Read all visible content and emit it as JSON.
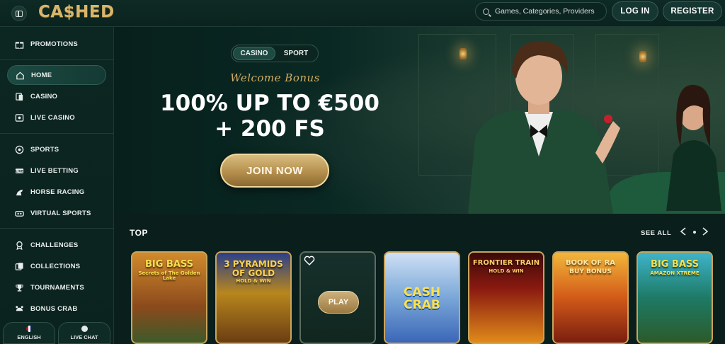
{
  "header": {
    "logo": "CA$HED",
    "search_placeholder": "Games, Categories, Providers",
    "login_label": "LOG IN",
    "register_label": "REGISTER"
  },
  "sidebar": {
    "items": [
      {
        "label": "PROMOTIONS",
        "icon": "gift-icon"
      },
      {
        "label": "HOME",
        "icon": "home-icon",
        "active": true
      },
      {
        "label": "CASINO",
        "icon": "cards-icon"
      },
      {
        "label": "LIVE CASINO",
        "icon": "live-cards-icon"
      },
      {
        "label": "SPORTS",
        "icon": "sports-icon"
      },
      {
        "label": "LIVE BETTING",
        "icon": "live-icon"
      },
      {
        "label": "HORSE RACING",
        "icon": "horse-icon"
      },
      {
        "label": "VIRTUAL SPORTS",
        "icon": "vr-icon"
      },
      {
        "label": "CHALLENGES",
        "icon": "award-icon"
      },
      {
        "label": "COLLECTIONS",
        "icon": "collection-icon"
      },
      {
        "label": "TOURNAMENTS",
        "icon": "trophy-icon"
      },
      {
        "label": "BONUS CRAB",
        "icon": "crab-icon"
      }
    ],
    "footer": {
      "language_label": "ENGLISH",
      "chat_label": "LIVE CHAT"
    }
  },
  "hero": {
    "toggle": [
      "CASINO",
      "SPORT"
    ],
    "toggle_active": "CASINO",
    "welcome": "Welcome Bonus",
    "offer_line1": "100% UP TO €500",
    "offer_line2": "+ 200 FS",
    "cta_label": "JOIN NOW"
  },
  "top": {
    "title": "TOP",
    "see_all": "SEE ALL",
    "games": [
      {
        "title": "BIG BASS",
        "subtitle": "Secrets of The Golden Lake"
      },
      {
        "title": "3 PYRAMIDS OF GOLD",
        "subtitle": "HOLD & WIN"
      },
      {
        "title": "",
        "subtitle": "",
        "play_label": "PLAY"
      },
      {
        "title": "CASH CRAB",
        "subtitle": ""
      },
      {
        "title": "FRONTIER TRAIN",
        "subtitle": "HOLD & WIN"
      },
      {
        "title": "BOOK OF RA",
        "subtitle": "BUY BONUS"
      },
      {
        "title": "BIG BASS",
        "subtitle": "AMAZON XTREME"
      }
    ]
  },
  "colors": {
    "background": "#0a1f1c",
    "gold": "#c9a45c",
    "accent_green": "#1d4a41"
  }
}
